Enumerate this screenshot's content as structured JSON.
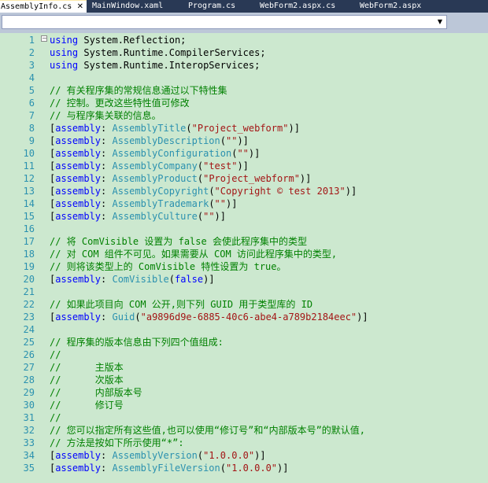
{
  "tabs": [
    {
      "label": "AssemblyInfo.cs",
      "active": true,
      "close": "✕"
    },
    {
      "label": "MainWindow.xaml",
      "active": false
    },
    {
      "label": "Program.cs",
      "active": false
    },
    {
      "label": "WebForm2.aspx.cs",
      "active": false
    },
    {
      "label": "WebForm2.aspx",
      "active": false
    }
  ],
  "navigation": {
    "dropdown_arrow": "▼"
  },
  "colors": {
    "keyword": "#0000ff",
    "comment": "#008000",
    "type": "#2b91af",
    "string": "#a31515",
    "background": "#cce8cf"
  },
  "lines": [
    {
      "n": "1",
      "segs": [
        {
          "c": "kw",
          "t": "using"
        },
        {
          "c": "tx",
          "t": " System.Reflection;"
        }
      ]
    },
    {
      "n": "2",
      "segs": [
        {
          "c": "kw",
          "t": "using"
        },
        {
          "c": "tx",
          "t": " System.Runtime.CompilerServices;"
        }
      ]
    },
    {
      "n": "3",
      "segs": [
        {
          "c": "kw",
          "t": "using"
        },
        {
          "c": "tx",
          "t": " System.Runtime.InteropServices;"
        }
      ]
    },
    {
      "n": "4",
      "segs": []
    },
    {
      "n": "5",
      "segs": [
        {
          "c": "cm",
          "t": "// 有关程序集的常规信息通过以下特性集"
        }
      ]
    },
    {
      "n": "6",
      "segs": [
        {
          "c": "cm",
          "t": "// 控制。更改这些特性值可修改"
        }
      ]
    },
    {
      "n": "7",
      "segs": [
        {
          "c": "cm",
          "t": "// 与程序集关联的信息。"
        }
      ]
    },
    {
      "n": "8",
      "segs": [
        {
          "c": "tx",
          "t": "["
        },
        {
          "c": "kw",
          "t": "assembly"
        },
        {
          "c": "tx",
          "t": ": "
        },
        {
          "c": "ty",
          "t": "AssemblyTitle"
        },
        {
          "c": "tx",
          "t": "("
        },
        {
          "c": "st",
          "t": "\"Project_webform\""
        },
        {
          "c": "tx",
          "t": ")]"
        }
      ]
    },
    {
      "n": "9",
      "segs": [
        {
          "c": "tx",
          "t": "["
        },
        {
          "c": "kw",
          "t": "assembly"
        },
        {
          "c": "tx",
          "t": ": "
        },
        {
          "c": "ty",
          "t": "AssemblyDescription"
        },
        {
          "c": "tx",
          "t": "("
        },
        {
          "c": "st",
          "t": "\"\""
        },
        {
          "c": "tx",
          "t": ")]"
        }
      ]
    },
    {
      "n": "10",
      "segs": [
        {
          "c": "tx",
          "t": "["
        },
        {
          "c": "kw",
          "t": "assembly"
        },
        {
          "c": "tx",
          "t": ": "
        },
        {
          "c": "ty",
          "t": "AssemblyConfiguration"
        },
        {
          "c": "tx",
          "t": "("
        },
        {
          "c": "st",
          "t": "\"\""
        },
        {
          "c": "tx",
          "t": ")]"
        }
      ]
    },
    {
      "n": "11",
      "segs": [
        {
          "c": "tx",
          "t": "["
        },
        {
          "c": "kw",
          "t": "assembly"
        },
        {
          "c": "tx",
          "t": ": "
        },
        {
          "c": "ty",
          "t": "AssemblyCompany"
        },
        {
          "c": "tx",
          "t": "("
        },
        {
          "c": "st",
          "t": "\"test\""
        },
        {
          "c": "tx",
          "t": ")]"
        }
      ]
    },
    {
      "n": "12",
      "segs": [
        {
          "c": "tx",
          "t": "["
        },
        {
          "c": "kw",
          "t": "assembly"
        },
        {
          "c": "tx",
          "t": ": "
        },
        {
          "c": "ty",
          "t": "AssemblyProduct"
        },
        {
          "c": "tx",
          "t": "("
        },
        {
          "c": "st",
          "t": "\"Project_webform\""
        },
        {
          "c": "tx",
          "t": ")]"
        }
      ]
    },
    {
      "n": "13",
      "segs": [
        {
          "c": "tx",
          "t": "["
        },
        {
          "c": "kw",
          "t": "assembly"
        },
        {
          "c": "tx",
          "t": ": "
        },
        {
          "c": "ty",
          "t": "AssemblyCopyright"
        },
        {
          "c": "tx",
          "t": "("
        },
        {
          "c": "st",
          "t": "\"Copyright © test 2013\""
        },
        {
          "c": "tx",
          "t": ")]"
        }
      ]
    },
    {
      "n": "14",
      "segs": [
        {
          "c": "tx",
          "t": "["
        },
        {
          "c": "kw",
          "t": "assembly"
        },
        {
          "c": "tx",
          "t": ": "
        },
        {
          "c": "ty",
          "t": "AssemblyTrademark"
        },
        {
          "c": "tx",
          "t": "("
        },
        {
          "c": "st",
          "t": "\"\""
        },
        {
          "c": "tx",
          "t": ")]"
        }
      ]
    },
    {
      "n": "15",
      "segs": [
        {
          "c": "tx",
          "t": "["
        },
        {
          "c": "kw",
          "t": "assembly"
        },
        {
          "c": "tx",
          "t": ": "
        },
        {
          "c": "ty",
          "t": "AssemblyCulture"
        },
        {
          "c": "tx",
          "t": "("
        },
        {
          "c": "st",
          "t": "\"\""
        },
        {
          "c": "tx",
          "t": ")]"
        }
      ]
    },
    {
      "n": "16",
      "segs": []
    },
    {
      "n": "17",
      "segs": [
        {
          "c": "cm",
          "t": "// 将 ComVisible 设置为 false 会使此程序集中的类型"
        }
      ]
    },
    {
      "n": "18",
      "segs": [
        {
          "c": "cm",
          "t": "// 对 COM 组件不可见。如果需要从 COM 访问此程序集中的类型,"
        }
      ]
    },
    {
      "n": "19",
      "segs": [
        {
          "c": "cm",
          "t": "// 则将该类型上的 ComVisible 特性设置为 true。"
        }
      ]
    },
    {
      "n": "20",
      "segs": [
        {
          "c": "tx",
          "t": "["
        },
        {
          "c": "kw",
          "t": "assembly"
        },
        {
          "c": "tx",
          "t": ": "
        },
        {
          "c": "ty",
          "t": "ComVisible"
        },
        {
          "c": "tx",
          "t": "("
        },
        {
          "c": "kw",
          "t": "false"
        },
        {
          "c": "tx",
          "t": ")]"
        }
      ]
    },
    {
      "n": "21",
      "segs": []
    },
    {
      "n": "22",
      "segs": [
        {
          "c": "cm",
          "t": "// 如果此项目向 COM 公开,则下列 GUID 用于类型库的 ID"
        }
      ]
    },
    {
      "n": "23",
      "segs": [
        {
          "c": "tx",
          "t": "["
        },
        {
          "c": "kw",
          "t": "assembly"
        },
        {
          "c": "tx",
          "t": ": "
        },
        {
          "c": "ty",
          "t": "Guid"
        },
        {
          "c": "tx",
          "t": "("
        },
        {
          "c": "st",
          "t": "\"a9896d9e-6885-40c6-abe4-a789b2184eec\""
        },
        {
          "c": "tx",
          "t": ")]"
        }
      ]
    },
    {
      "n": "24",
      "segs": []
    },
    {
      "n": "25",
      "segs": [
        {
          "c": "cm",
          "t": "// 程序集的版本信息由下列四个值组成:"
        }
      ]
    },
    {
      "n": "26",
      "segs": [
        {
          "c": "cm",
          "t": "//"
        }
      ]
    },
    {
      "n": "27",
      "segs": [
        {
          "c": "cm",
          "t": "//      主版本"
        }
      ]
    },
    {
      "n": "28",
      "segs": [
        {
          "c": "cm",
          "t": "//      次版本"
        }
      ]
    },
    {
      "n": "29",
      "segs": [
        {
          "c": "cm",
          "t": "//      内部版本号"
        }
      ]
    },
    {
      "n": "30",
      "segs": [
        {
          "c": "cm",
          "t": "//      修订号"
        }
      ]
    },
    {
      "n": "31",
      "segs": [
        {
          "c": "cm",
          "t": "//"
        }
      ]
    },
    {
      "n": "32",
      "segs": [
        {
          "c": "cm",
          "t": "// 您可以指定所有这些值,也可以使用“修订号”和“内部版本号”的默认值,"
        }
      ]
    },
    {
      "n": "33",
      "segs": [
        {
          "c": "cm",
          "t": "// 方法是按如下所示使用“*”:"
        }
      ]
    },
    {
      "n": "34",
      "segs": [
        {
          "c": "tx",
          "t": "["
        },
        {
          "c": "kw",
          "t": "assembly"
        },
        {
          "c": "tx",
          "t": ": "
        },
        {
          "c": "ty",
          "t": "AssemblyVersion"
        },
        {
          "c": "tx",
          "t": "("
        },
        {
          "c": "st",
          "t": "\"1.0.0.0\""
        },
        {
          "c": "tx",
          "t": ")]"
        }
      ]
    },
    {
      "n": "35",
      "segs": [
        {
          "c": "tx",
          "t": "["
        },
        {
          "c": "kw",
          "t": "assembly"
        },
        {
          "c": "tx",
          "t": ": "
        },
        {
          "c": "ty",
          "t": "AssemblyFileVersion"
        },
        {
          "c": "tx",
          "t": "("
        },
        {
          "c": "st",
          "t": "\"1.0.0.0\""
        },
        {
          "c": "tx",
          "t": ")]"
        }
      ]
    }
  ]
}
